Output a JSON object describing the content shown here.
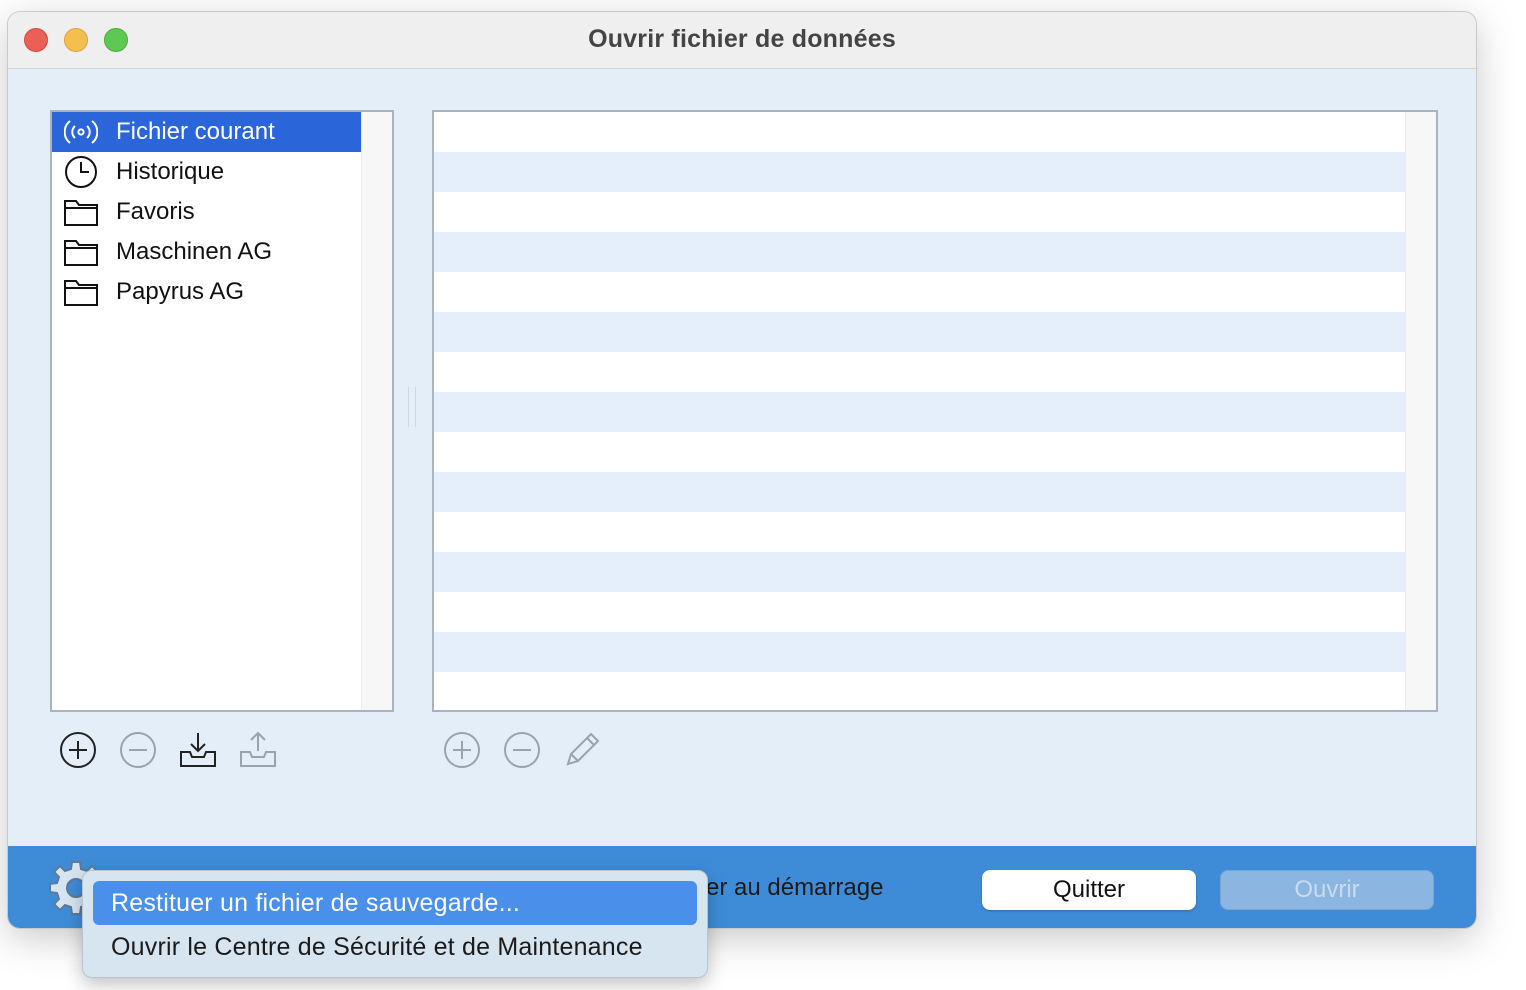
{
  "window": {
    "title": "Ouvrir fichier de données"
  },
  "sidebar": {
    "items": [
      {
        "label": "Fichier courant",
        "icon": "broadcast-icon",
        "selected": true
      },
      {
        "label": "Historique",
        "icon": "clock-icon",
        "selected": false
      },
      {
        "label": "Favoris",
        "icon": "folder-icon",
        "selected": false
      },
      {
        "label": "Maschinen AG",
        "icon": "folder-icon",
        "selected": false
      },
      {
        "label": "Papyrus AG",
        "icon": "folder-icon",
        "selected": false
      }
    ]
  },
  "left_toolbar": [
    "add-icon",
    "remove-icon",
    "import-icon",
    "export-icon"
  ],
  "right_toolbar": [
    "add-icon",
    "remove-icon",
    "pencil-icon"
  ],
  "bottom": {
    "startup_label": "er au démarrage",
    "quit_label": "Quitter",
    "open_label": "Ouvrir"
  },
  "gear_menu": {
    "items": [
      {
        "label": "Restituer un fichier de sauvegarde...",
        "highlighted": true
      },
      {
        "label": "Ouvrir le Centre de Sécurité et de Maintenance",
        "highlighted": false
      }
    ]
  },
  "colors": {
    "selection": "#2a66d9",
    "bottom_bar": "#3e8cd8",
    "menu_highlight": "#4a8fea",
    "row_alt": "#e4effb"
  }
}
